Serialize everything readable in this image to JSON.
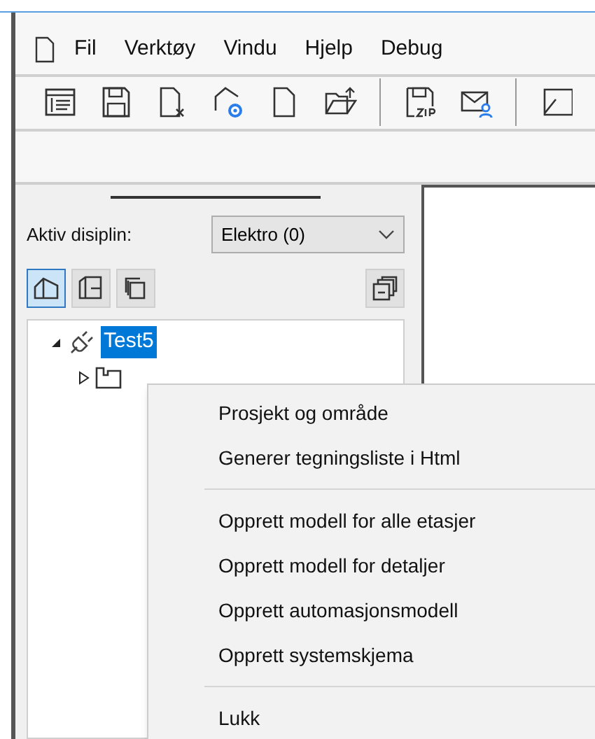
{
  "menu_bar": {
    "items": [
      "Fil",
      "Verktøy",
      "Vindu",
      "Hjelp",
      "Debug"
    ]
  },
  "toolbar": {
    "buttons": [
      {
        "kind": "properties"
      },
      {
        "kind": "save"
      },
      {
        "kind": "close-doc"
      },
      {
        "kind": "settings"
      },
      {
        "kind": "new"
      },
      {
        "kind": "open"
      },
      {
        "kind": "sep"
      },
      {
        "kind": "zip"
      },
      {
        "kind": "mail"
      },
      {
        "kind": "sep"
      },
      {
        "kind": "partial"
      }
    ]
  },
  "side_panel": {
    "discipline_label": "Aktiv disiplin:",
    "discipline_value": "Elektro (0)",
    "view_buttons": [
      {
        "kind": "building",
        "selected": true
      },
      {
        "kind": "floor",
        "selected": false
      },
      {
        "kind": "layers",
        "selected": false
      }
    ],
    "tree": [
      {
        "label": "Test5",
        "selected": true,
        "expanded": true,
        "children": [
          {
            "expanded": false
          }
        ]
      }
    ]
  },
  "context_menu": {
    "items": [
      {
        "kind": "item",
        "label": "Prosjekt og område"
      },
      {
        "kind": "item",
        "label": "Generer tegningsliste i Html"
      },
      {
        "kind": "separator"
      },
      {
        "kind": "item",
        "label": "Opprett modell for alle etasjer"
      },
      {
        "kind": "item",
        "label": "Opprett modell for detaljer"
      },
      {
        "kind": "item",
        "label": "Opprett automasjonsmodell"
      },
      {
        "kind": "item",
        "label": "Opprett systemskjema"
      },
      {
        "kind": "separator"
      },
      {
        "kind": "item",
        "label": "Lukk"
      }
    ]
  }
}
